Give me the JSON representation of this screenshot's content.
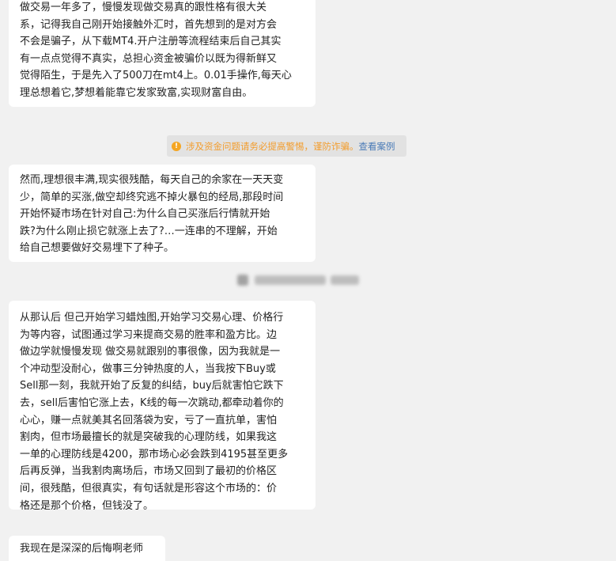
{
  "chat": {
    "messages": [
      {
        "text": "做交易一年多了，慢慢发现做交易真的跟性格有很大关\n系，记得我自己刚开始接触外汇时，首先想到的是对方会\n不会是骗子，从下载MT4.开户注册等流程结束后自己其实\n有一点点觉得不真实，总担心资金被骗价以既为得新鲜又\n觉得陌生，于是先入了500刀在mt4上。0.01手操作,每天心\n理总想着它,梦想着能靠它发家致富,实现财富自由。"
      },
      {
        "text": "然而,理想很丰满,现实很残酷，每天自己的余家在一天天变\n少，简单的买涨,做空却终究逃不掉火暴包的经局,那段时间\n开始怀疑市场在针对自己:为什么自己买涨后行情就开始\n跌?为什么刚止损它就涨上去了?…一连串的不理解，开始\n给自己想要做好交易埋下了种子。"
      },
      {
        "text": "从那认后 但己开始学习蜡烛图,开始学习交易心理、价格行\n为等内容，试图通过学习来提商交易的胜率和盈方比。边\n做边学就慢慢发现 做交易就跟别的事很像，因为我就是一\n个冲动型没耐心，做事三分钟热度的人，当我按下Buy或\nSell那一刻，我就开始了反复的纠结，buy后就害怕它跌下\n去，sell后害怕它涨上去，K线的每一次跳动,都牵动着你的\n心心，赚一点就美其名回落袋为安，亏了一直抗单，害怕\n割肉，但市场最擅长的就是突破我的心理防线，如果我这\n一单的心理防线是4200，那市场心必会跌到4195甚至更多\n后再反弹，当我割肉离场后，市场又回到了最初的价格区\n间，很残酷，但很真实，有句话就是形容这个市场的：价\n格还是那个价格，但钱没了。"
      },
      {
        "text": "我现在是深深的后悔啊老师"
      }
    ],
    "notice": {
      "icon": "!",
      "text": "涉及资金问题请务必提高警惕，谨防诈骗。",
      "link": "查看案例"
    }
  },
  "colors": {
    "background": "#f1f1f1",
    "bubble": "#ffffff",
    "notice_background": "#e2e2e2",
    "notice_text": "#f39c2b",
    "notice_link": "#4a7bb7",
    "warning_icon": "#f5a623"
  }
}
